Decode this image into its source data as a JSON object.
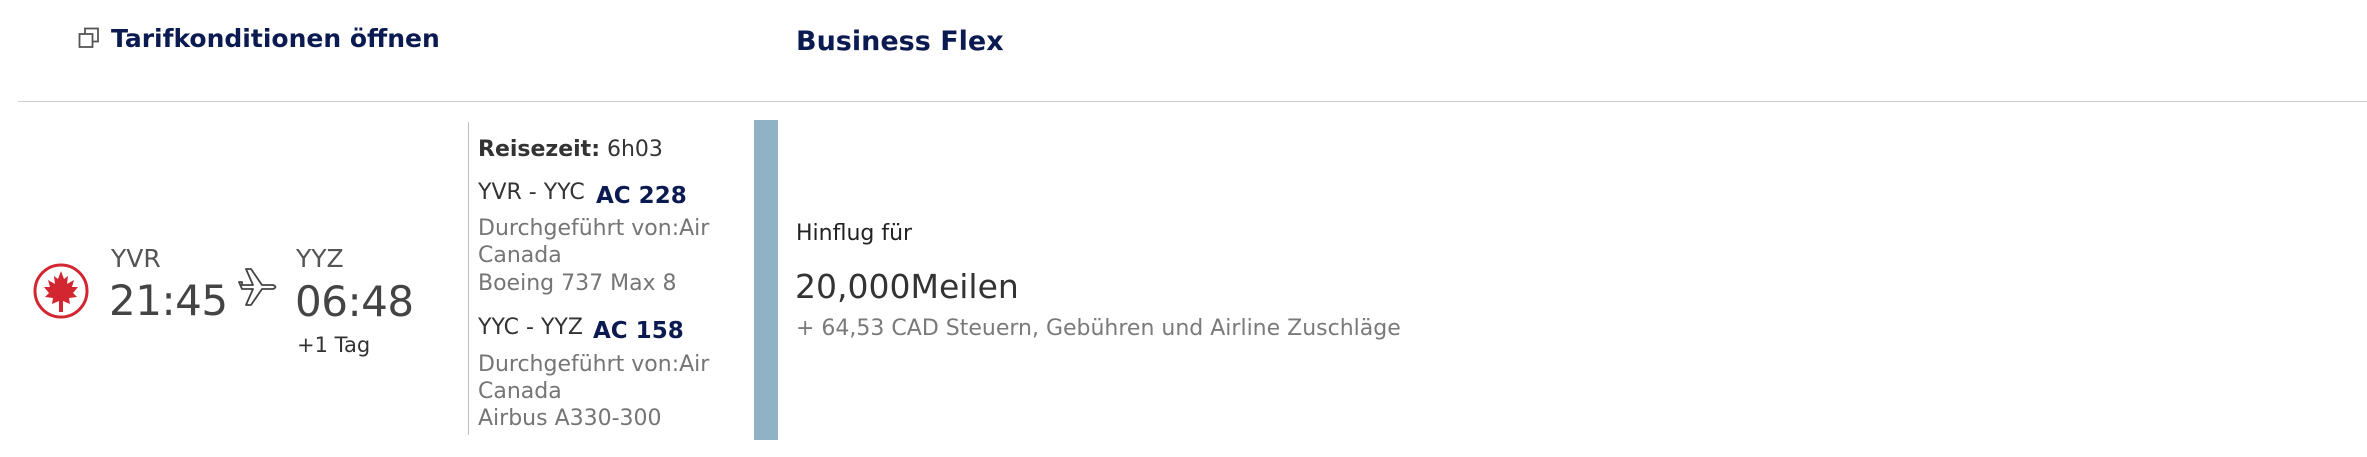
{
  "header": {
    "tarif_link": "Tarifkonditionen öffnen",
    "fare_name": "Business Flex"
  },
  "flight": {
    "airline_logo": "air-canada-maple-leaf",
    "departure": {
      "code": "YVR",
      "time": "21:45"
    },
    "arrival": {
      "code": "YYZ",
      "time": "06:48",
      "day_offset": "+1 Tag"
    },
    "travel_time_label": "Reisezeit:",
    "travel_time_value": " 6h03",
    "segments": [
      {
        "route": "YVR - YYC",
        "flight_no": "AC 228",
        "operated_by_1": "Durchgeführt von:Air",
        "operated_by_2": "Canada",
        "aircraft": "Boeing 737 Max 8"
      },
      {
        "route": "YYC - YYZ",
        "flight_no": "AC 158",
        "operated_by_1": "Durchgeführt von:Air",
        "operated_by_2": "Canada",
        "aircraft": "Airbus A330-300"
      }
    ]
  },
  "fare": {
    "label": "Hinflug für",
    "price": "20,000Meilen",
    "taxes": "+ 64,53 CAD Steuern, Gebühren und Airline Zuschläge",
    "accent_color": "#8fb3c4"
  },
  "colors": {
    "navy": "#0b1a51",
    "air_canada_red": "#d22630"
  }
}
